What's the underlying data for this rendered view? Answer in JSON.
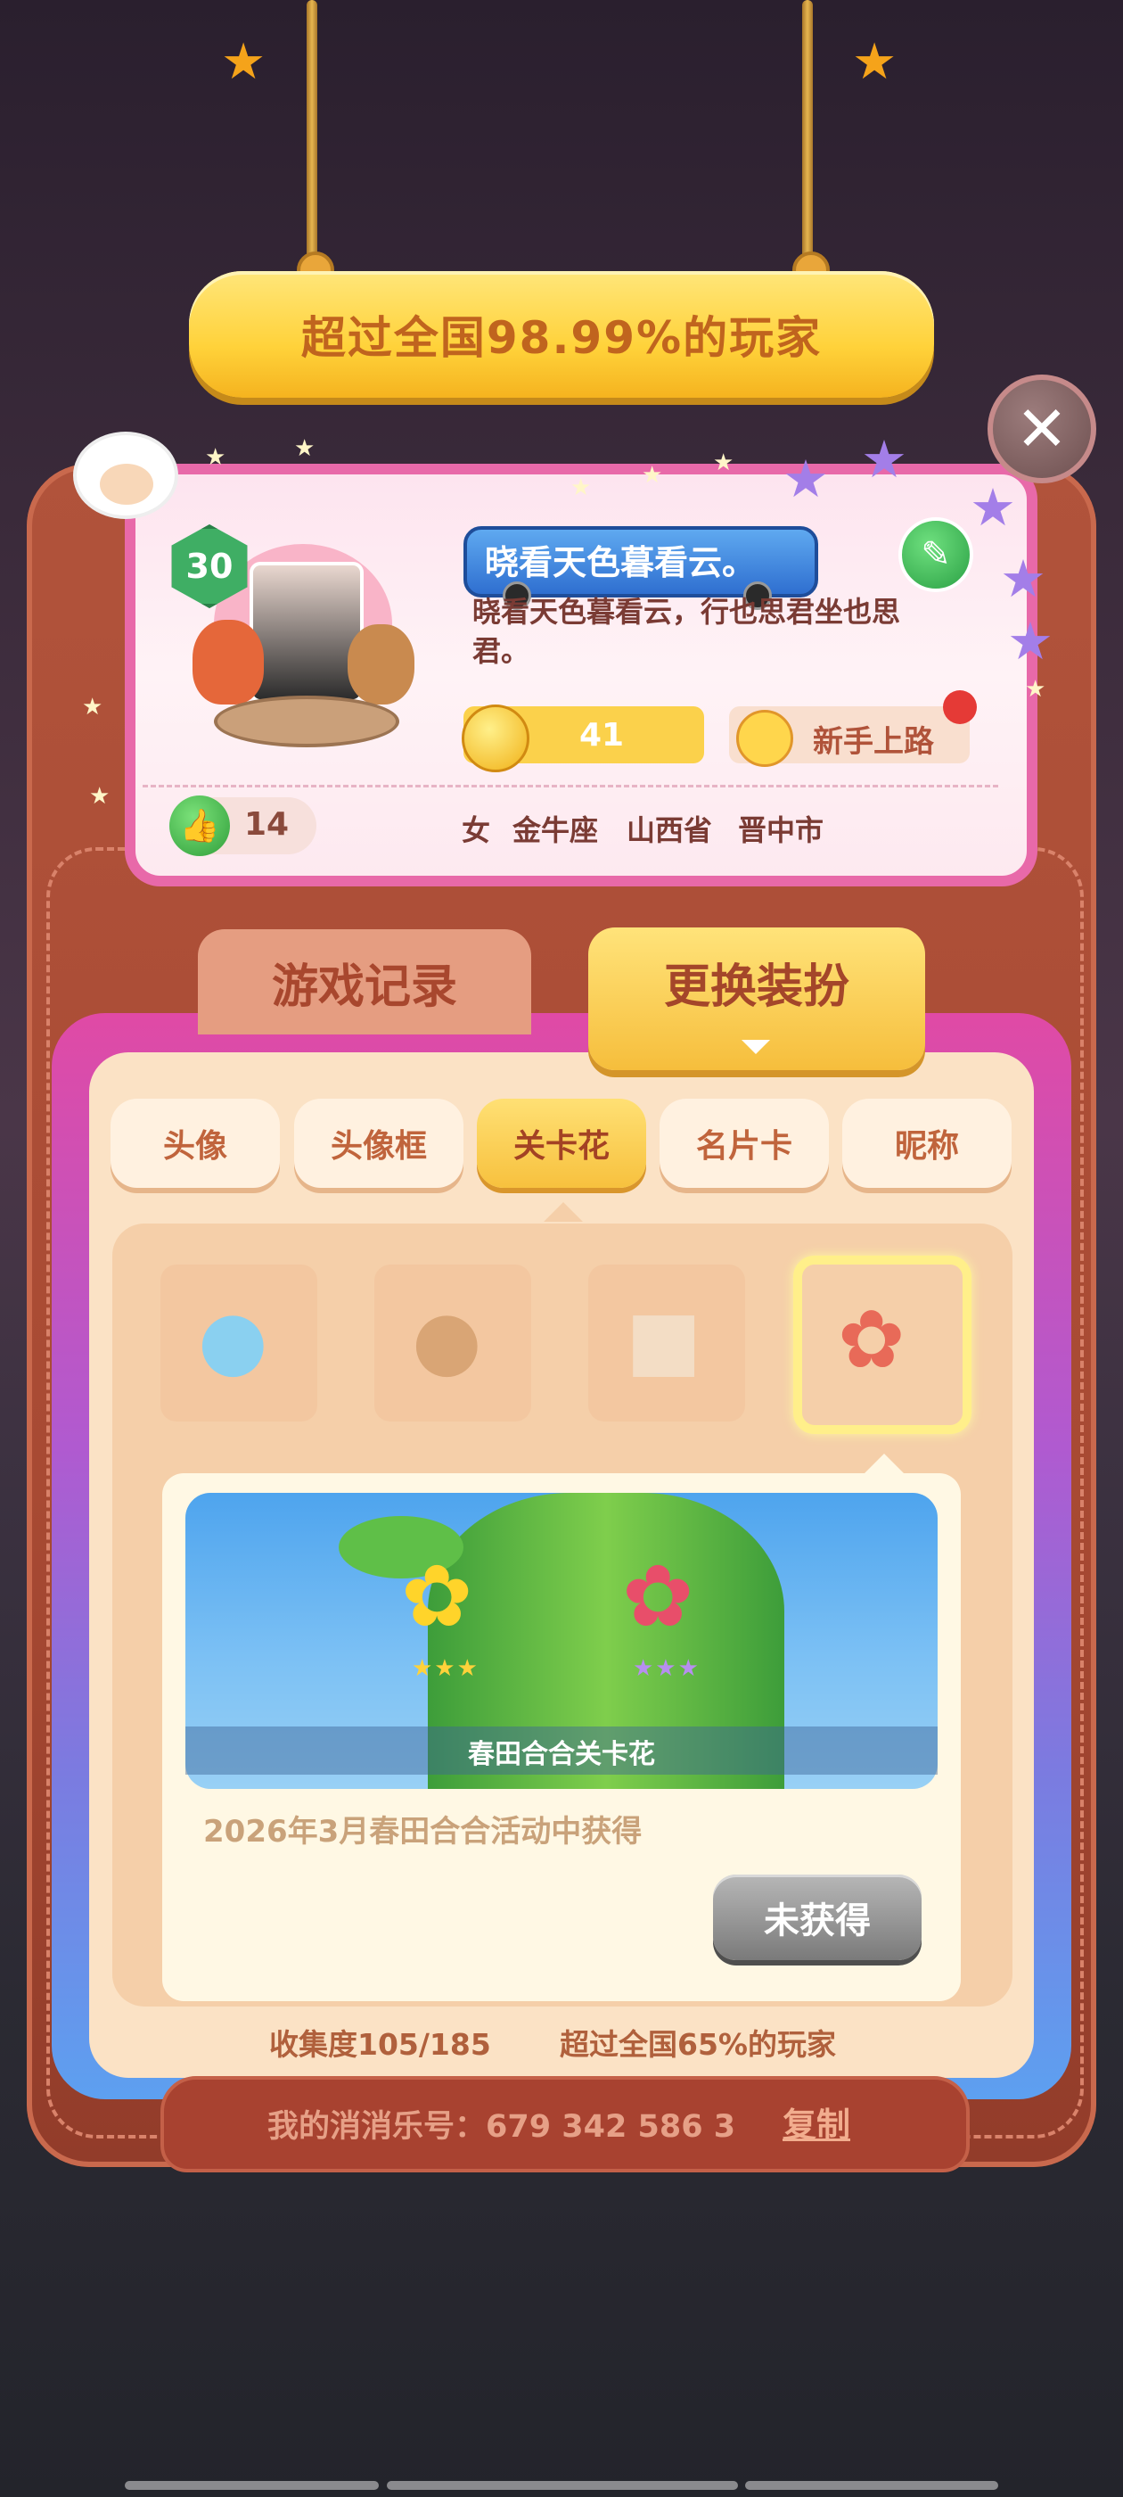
{
  "banner": {
    "text": "超过全国98.99%的玩家"
  },
  "profile": {
    "level": "30",
    "nickname_banner": "晓看天色暮看云。",
    "signature": "晓看天色暮看云，行也思君坐也思君。",
    "coins": "41",
    "rank_title": "新手上路",
    "likes": "14",
    "gender": "女",
    "zodiac": "金牛座",
    "province": "山西省",
    "city": "晋中市"
  },
  "main_tabs": {
    "game_records": "游戏记录",
    "change_outfit": "更换装扮"
  },
  "categories": [
    "头像",
    "头像框",
    "关卡花",
    "名片卡",
    "昵称"
  ],
  "active_category": "关卡花",
  "detail": {
    "preview_label": "春田合合关卡花",
    "source": "2026年3月春田合合活动中获得",
    "button": "未获得",
    "stars": "★★★"
  },
  "stats": {
    "collection": "收集度105/185",
    "exceed": "超过全国65%的玩家"
  },
  "footer": {
    "id_label": "我的消消乐号：679 342 586 3",
    "copy": "复制"
  },
  "icons": {
    "close": "close-icon",
    "edit": "pencil-icon",
    "like": "thumbs-up-icon",
    "coin": "sun-coin-icon"
  },
  "colors": {
    "banner_text": "#c0641e",
    "active_tab": "#f7c13e",
    "unobtained": "#7a7a7a"
  }
}
